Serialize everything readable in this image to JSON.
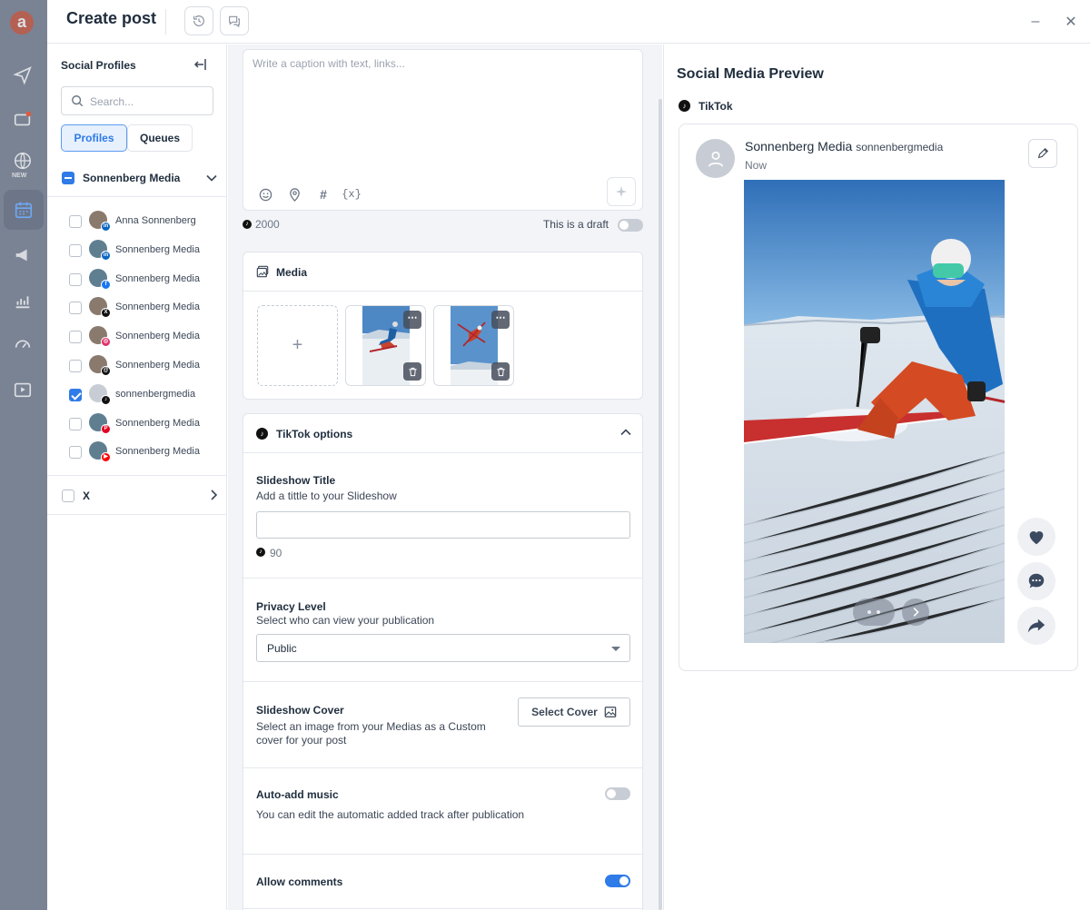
{
  "app": {
    "logo_letter": "a"
  },
  "rail": {
    "items": [
      "send-icon",
      "inbox-icon",
      "globe-icon",
      "calendar-icon",
      "megaphone-icon",
      "analytics-icon",
      "gauge-icon",
      "video-icon"
    ],
    "new_badge": "NEW",
    "active": "calendar-icon"
  },
  "header": {
    "title": "Create post",
    "buttons": [
      "history-icon",
      "comments-icon"
    ],
    "window_controls": [
      "minimize-icon",
      "close-icon"
    ]
  },
  "profiles": {
    "title": "Social Profiles",
    "search_placeholder": "Search...",
    "tabs": [
      "Profiles",
      "Queues"
    ],
    "active_tab": "Profiles",
    "group": {
      "name": "Sonnenberg Media",
      "state": "partial"
    },
    "items": [
      {
        "name": "Anna Sonnenberg",
        "network": "linkedin",
        "checked": false
      },
      {
        "name": "Sonnenberg Media",
        "network": "linkedin",
        "checked": false
      },
      {
        "name": "Sonnenberg Media",
        "network": "facebook",
        "checked": false
      },
      {
        "name": "Sonnenberg Media",
        "network": "x",
        "checked": false
      },
      {
        "name": "Sonnenberg Media",
        "network": "instagram",
        "checked": false
      },
      {
        "name": "Sonnenberg Media",
        "network": "threads",
        "checked": false
      },
      {
        "name": "sonnenbergmedia",
        "network": "tiktok",
        "checked": true
      },
      {
        "name": "Sonnenberg Media",
        "network": "pinterest",
        "checked": false
      },
      {
        "name": "Sonnenberg Media",
        "network": "youtube",
        "checked": false
      }
    ],
    "x_group": {
      "name": "X"
    }
  },
  "editor": {
    "caption_placeholder": "Write a caption with text, links...",
    "caption_value": "",
    "toolbar": [
      "emoji-icon",
      "location-icon",
      "hashtag-icon",
      "variable-icon"
    ],
    "char_count": "2000",
    "draft_label": "This is a draft",
    "draft_on": false,
    "media": {
      "title": "Media",
      "count": 2,
      "add_label": "+"
    },
    "tiktok": {
      "title": "TikTok options",
      "slideshow_title": {
        "label": "Slideshow Title",
        "desc": "Add a tittle to your Slideshow",
        "value": "",
        "char_count": "90"
      },
      "privacy": {
        "label": "Privacy Level",
        "desc": "Select who can view your publication",
        "value": "Public"
      },
      "cover": {
        "label": "Slideshow Cover",
        "desc": "Select an image from your Medias as a Custom cover for your post",
        "button": "Select Cover"
      },
      "music": {
        "label": "Auto-add music",
        "desc": "You can edit the automatic added track after publication",
        "on": false
      },
      "comments": {
        "label": "Allow comments",
        "on": true
      }
    }
  },
  "preview": {
    "title": "Social Media Preview",
    "network": "TikTok",
    "display_name": "Sonnenberg Media",
    "handle": "sonnenbergmedia",
    "time": "Now",
    "actions": [
      "heart-icon",
      "comment-icon",
      "share-icon"
    ]
  },
  "colors": {
    "accent": "#2f7be8",
    "rail": "#7a8394",
    "tiktok": "#111111"
  }
}
